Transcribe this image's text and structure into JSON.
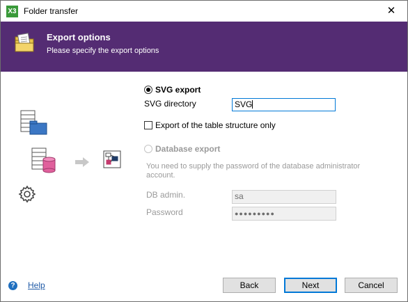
{
  "window": {
    "title": "Folder transfer",
    "app_icon_text": "X3",
    "close_glyph": "✕"
  },
  "header": {
    "title": "Export options",
    "subtitle": "Please specify the export options"
  },
  "form": {
    "svg_export": {
      "label": "SVG export",
      "selected": true
    },
    "svg_directory": {
      "label": "SVG directory",
      "value": "SVG"
    },
    "table_structure_only": {
      "label": "Export of the table structure only",
      "checked": false
    },
    "database_export": {
      "label": "Database export",
      "selected": false,
      "enabled": false
    },
    "password_note": "You need to supply the password of the database administrator account.",
    "db_admin": {
      "label": "DB admin.",
      "value": "sa"
    },
    "password": {
      "label": "Password",
      "value": "●●●●●●●●●"
    }
  },
  "footer": {
    "help_label": "Help",
    "help_icon": "?",
    "back_label": "Back",
    "next_label": "Next",
    "cancel_label": "Cancel"
  },
  "colors": {
    "header_bg": "#542c73",
    "accent": "#0078d7",
    "link": "#1f5aa6"
  },
  "icons": [
    "x3-app-icon",
    "close-icon",
    "folder-export-icon",
    "table-folder-icon",
    "table-database-icon",
    "arrow-right-icon",
    "diagram-icon",
    "gear-icon",
    "help-icon"
  ]
}
